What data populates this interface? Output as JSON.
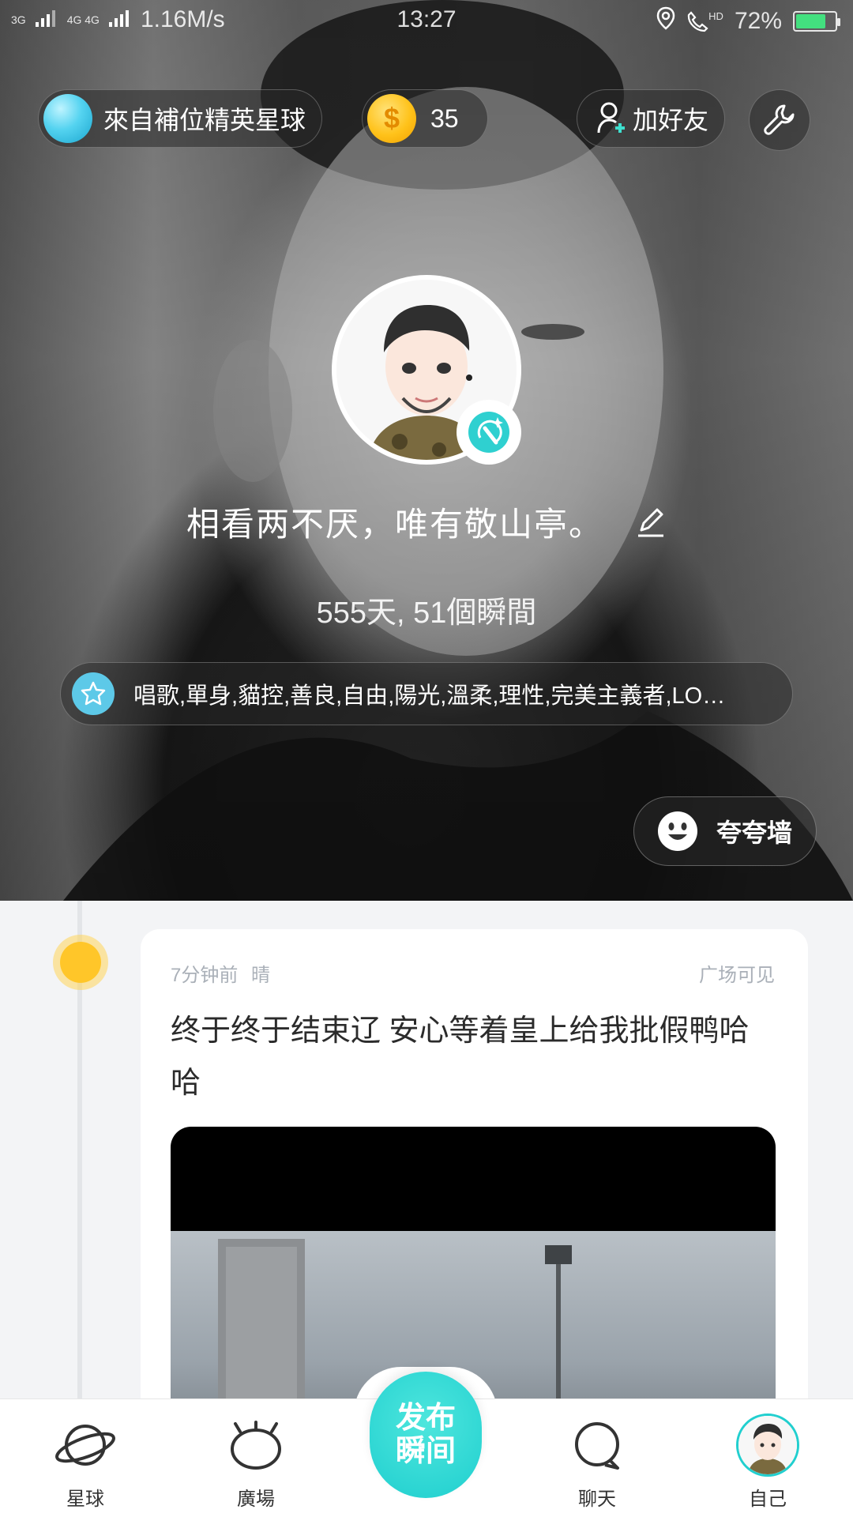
{
  "status_bar": {
    "network_left": "3G",
    "network_mid": "4G 4G",
    "speed": "1.16M/s",
    "time": "13:27",
    "hd": "HD",
    "battery_pct": "72%",
    "battery_level": 0.72,
    "battery_color": "#43e07f"
  },
  "header": {
    "planet_label": "來自補位精英星球",
    "coins": "35",
    "add_friend_label": "加好友"
  },
  "profile": {
    "motto": "相看两不厌，唯有敬山亭。",
    "stats": "555天, 51個瞬間",
    "tags": "唱歌,單身,貓控,善良,自由,陽光,溫柔,理性,完美主義者,LO…",
    "praise_wall": "夸夸墙"
  },
  "post": {
    "time_ago": "7分钟前",
    "weather": "晴",
    "visibility": "广场可见",
    "text": "终于终于结束辽 安心等着皇上给我批假鸭哈哈"
  },
  "tabbar": {
    "planet": "星球",
    "square": "廣場",
    "publish_line1": "发布",
    "publish_line2": "瞬间",
    "chat": "聊天",
    "self": "自己"
  },
  "colors": {
    "accent": "#1fcfcf",
    "coin": "#ffc21a",
    "sun": "#ffc629"
  }
}
